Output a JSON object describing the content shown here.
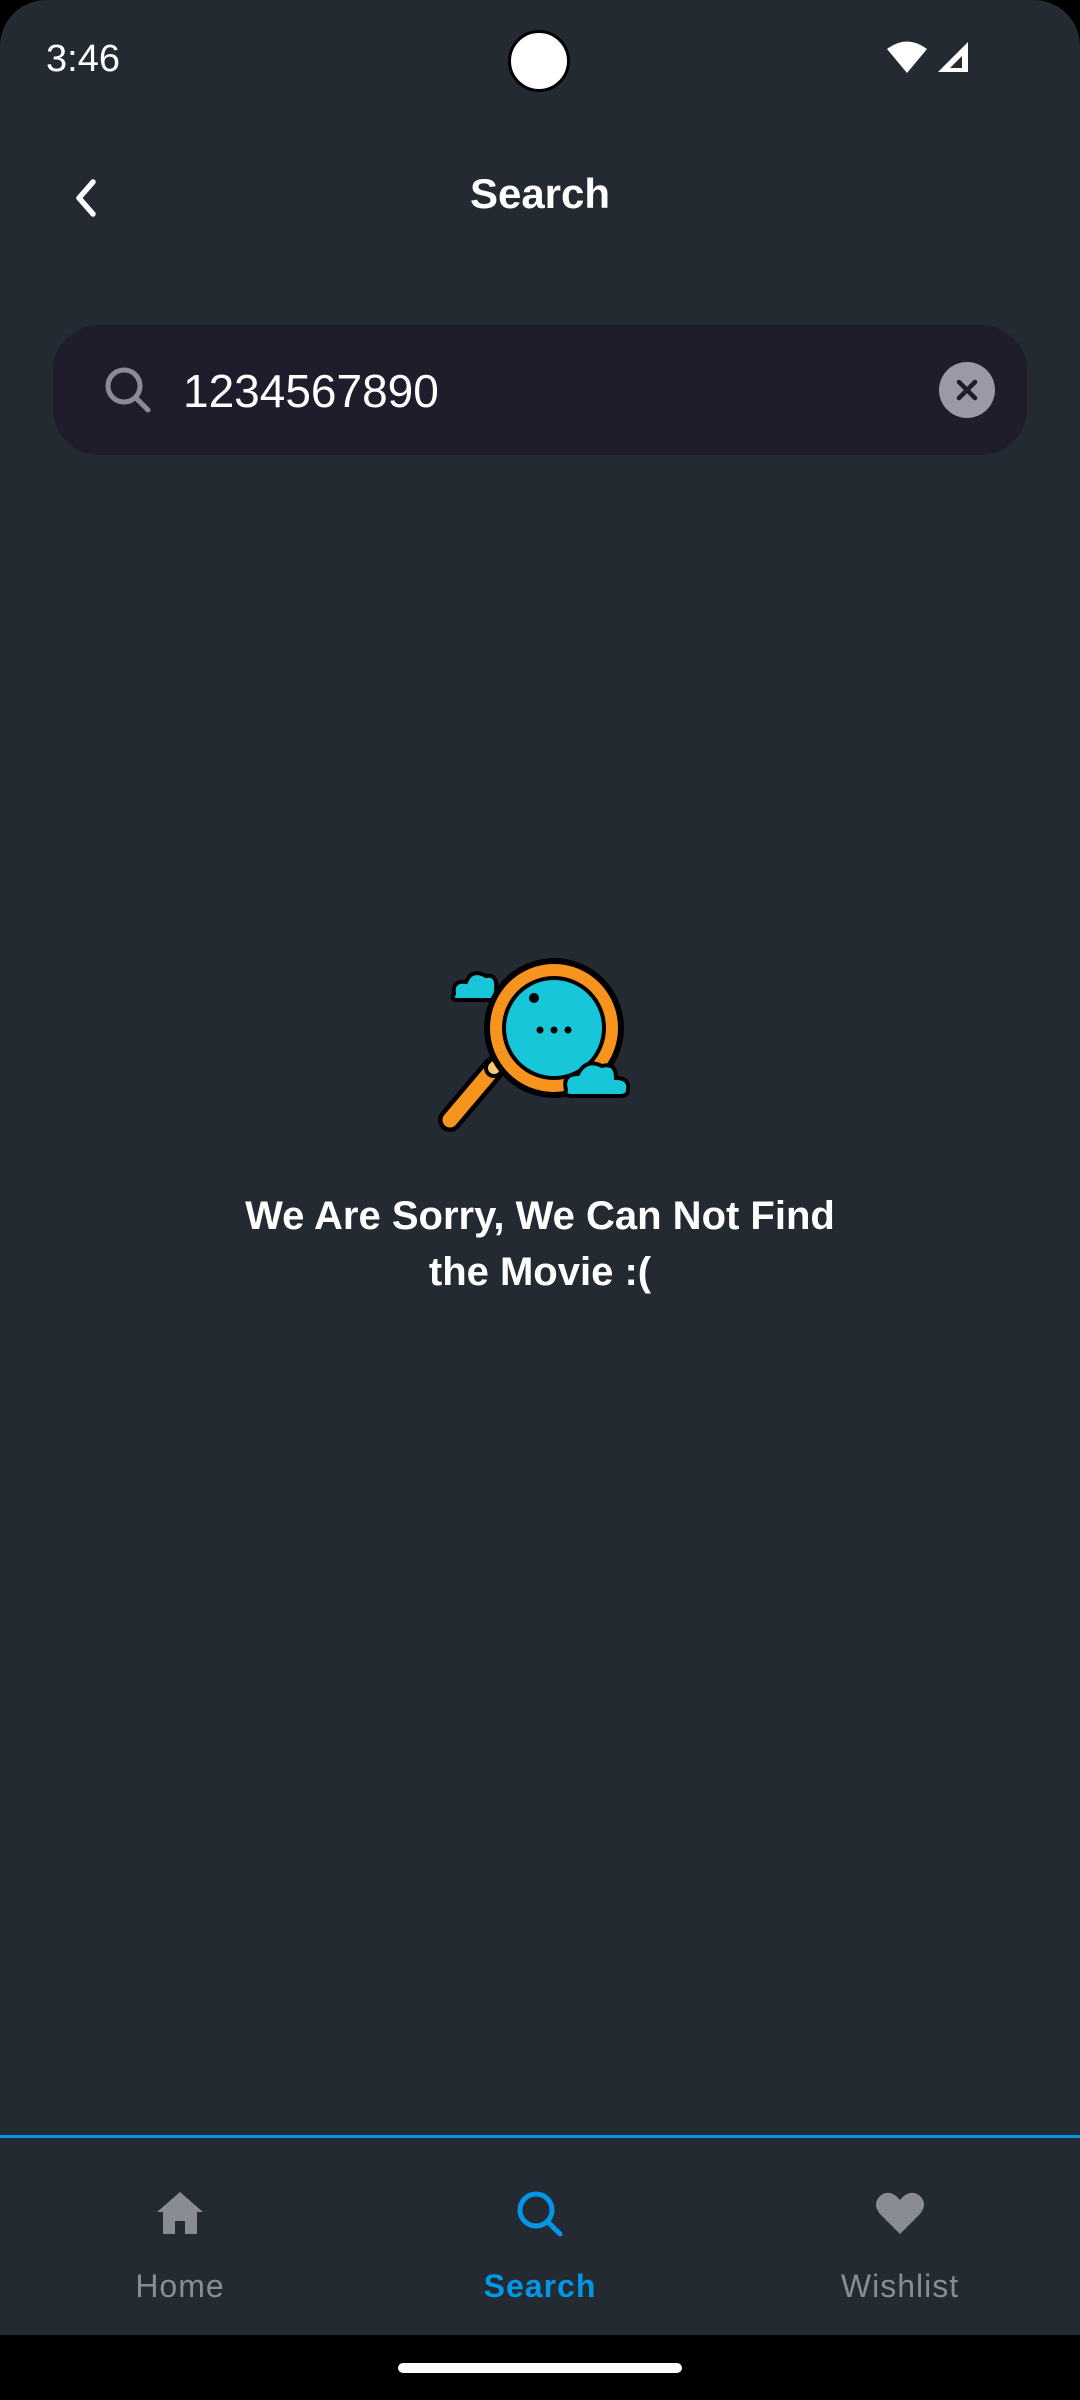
{
  "status_bar": {
    "time": "3:46"
  },
  "header": {
    "title": "Search"
  },
  "search": {
    "value": "1234567890",
    "placeholder": ""
  },
  "empty_state": {
    "line1": "We Are Sorry, We Can Not Find",
    "line2": "the Movie :("
  },
  "bottom_nav": {
    "items": [
      {
        "label": "Home",
        "icon": "home-icon",
        "active": false
      },
      {
        "label": "Search",
        "icon": "search-icon",
        "active": true
      },
      {
        "label": "Wishlist",
        "icon": "heart-icon",
        "active": false
      }
    ]
  },
  "colors": {
    "background": "#242a32",
    "search_field": "#1f1d2b",
    "accent": "#0296e5",
    "inactive": "#8a8c94"
  }
}
